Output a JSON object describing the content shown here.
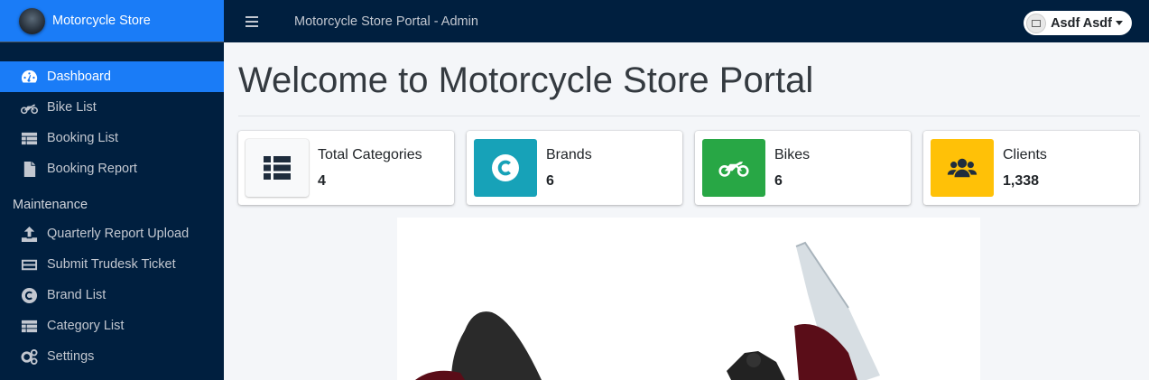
{
  "brand": {
    "name": "Motorcycle Store"
  },
  "sidebar": {
    "items": [
      {
        "label": "Dashboard",
        "icon": "tachometer-icon"
      },
      {
        "label": "Bike List",
        "icon": "motorcycle-icon"
      },
      {
        "label": "Booking List",
        "icon": "table-icon"
      },
      {
        "label": "Booking Report",
        "icon": "file-icon"
      }
    ],
    "maintenance_header": "Maintenance",
    "maintenance_items": [
      {
        "label": "Quarterly Report Upload",
        "icon": "upload-icon"
      },
      {
        "label": "Submit Trudesk Ticket",
        "icon": "keyboard-icon"
      },
      {
        "label": "Brand List",
        "icon": "copyright-icon"
      },
      {
        "label": "Category List",
        "icon": "table-icon"
      },
      {
        "label": "Settings",
        "icon": "gears-icon"
      }
    ]
  },
  "topbar": {
    "title": "Motorcycle Store Portal - Admin",
    "user_name": "Asdf Asdf"
  },
  "main": {
    "title": "Welcome to Motorcycle Store Portal",
    "stats": [
      {
        "label": "Total Categories",
        "value": "4",
        "color": "#f8f9fa",
        "icon": "th-list-icon"
      },
      {
        "label": "Brands",
        "value": "6",
        "color": "#17a2b8",
        "icon": "copyright-icon"
      },
      {
        "label": "Bikes",
        "value": "6",
        "color": "#28a745",
        "icon": "motorcycle-icon"
      },
      {
        "label": "Clients",
        "value": "1,338",
        "color": "#ffc107",
        "icon": "users-icon"
      }
    ]
  },
  "colors": {
    "sidebar_bg": "#001f3f",
    "accent": "#1a7cf7",
    "content_bg": "#f4f6f9"
  }
}
